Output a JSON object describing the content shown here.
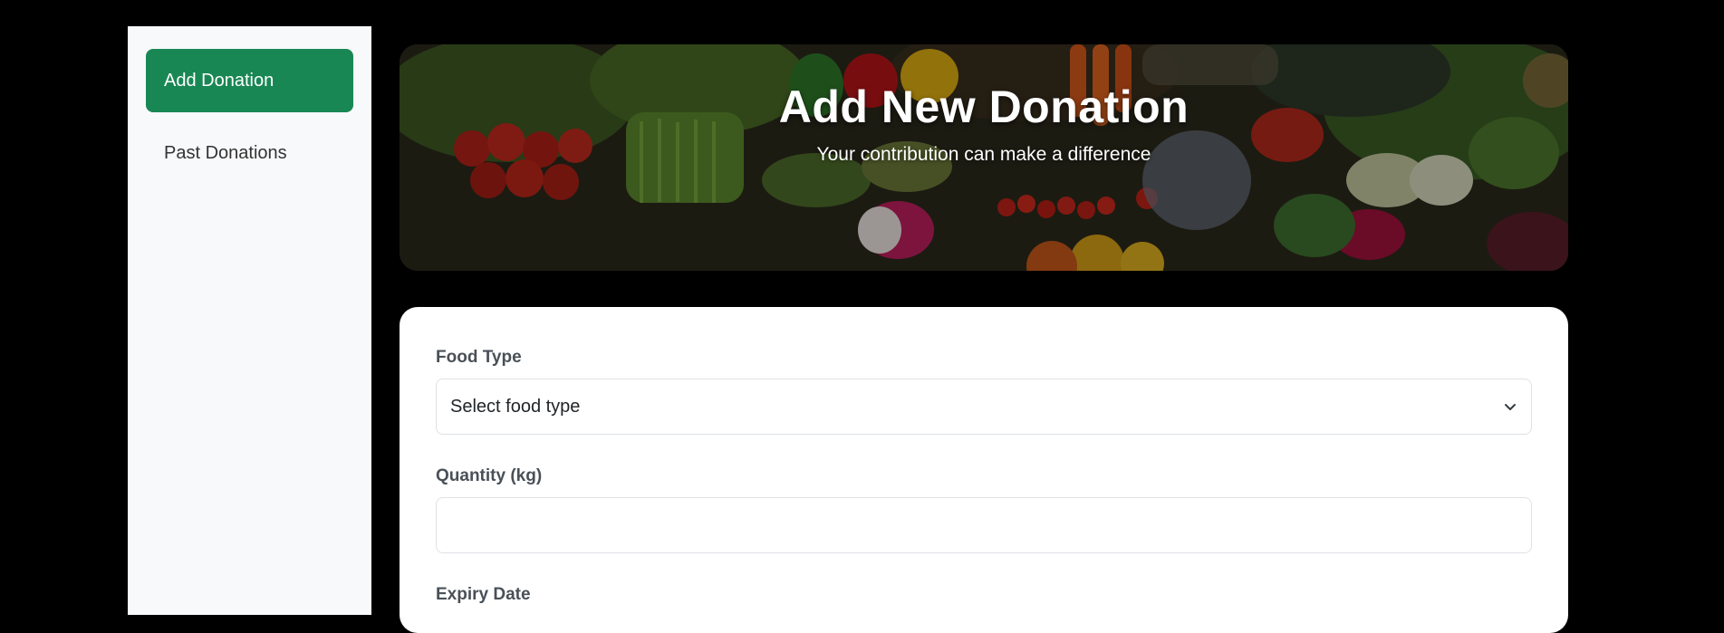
{
  "sidebar": {
    "items": [
      {
        "label": "Add Donation",
        "active": true
      },
      {
        "label": "Past Donations",
        "active": false
      }
    ]
  },
  "hero": {
    "title": "Add New Donation",
    "subtitle": "Your contribution can make a difference"
  },
  "form": {
    "food_type": {
      "label": "Food Type",
      "selected": "Select food type"
    },
    "quantity": {
      "label": "Quantity (kg)",
      "value": ""
    },
    "expiry": {
      "label": "Expiry Date"
    }
  },
  "colors": {
    "accent": "#198754",
    "sidebar_bg": "#f8f9fa",
    "page_bg": "#000000"
  }
}
